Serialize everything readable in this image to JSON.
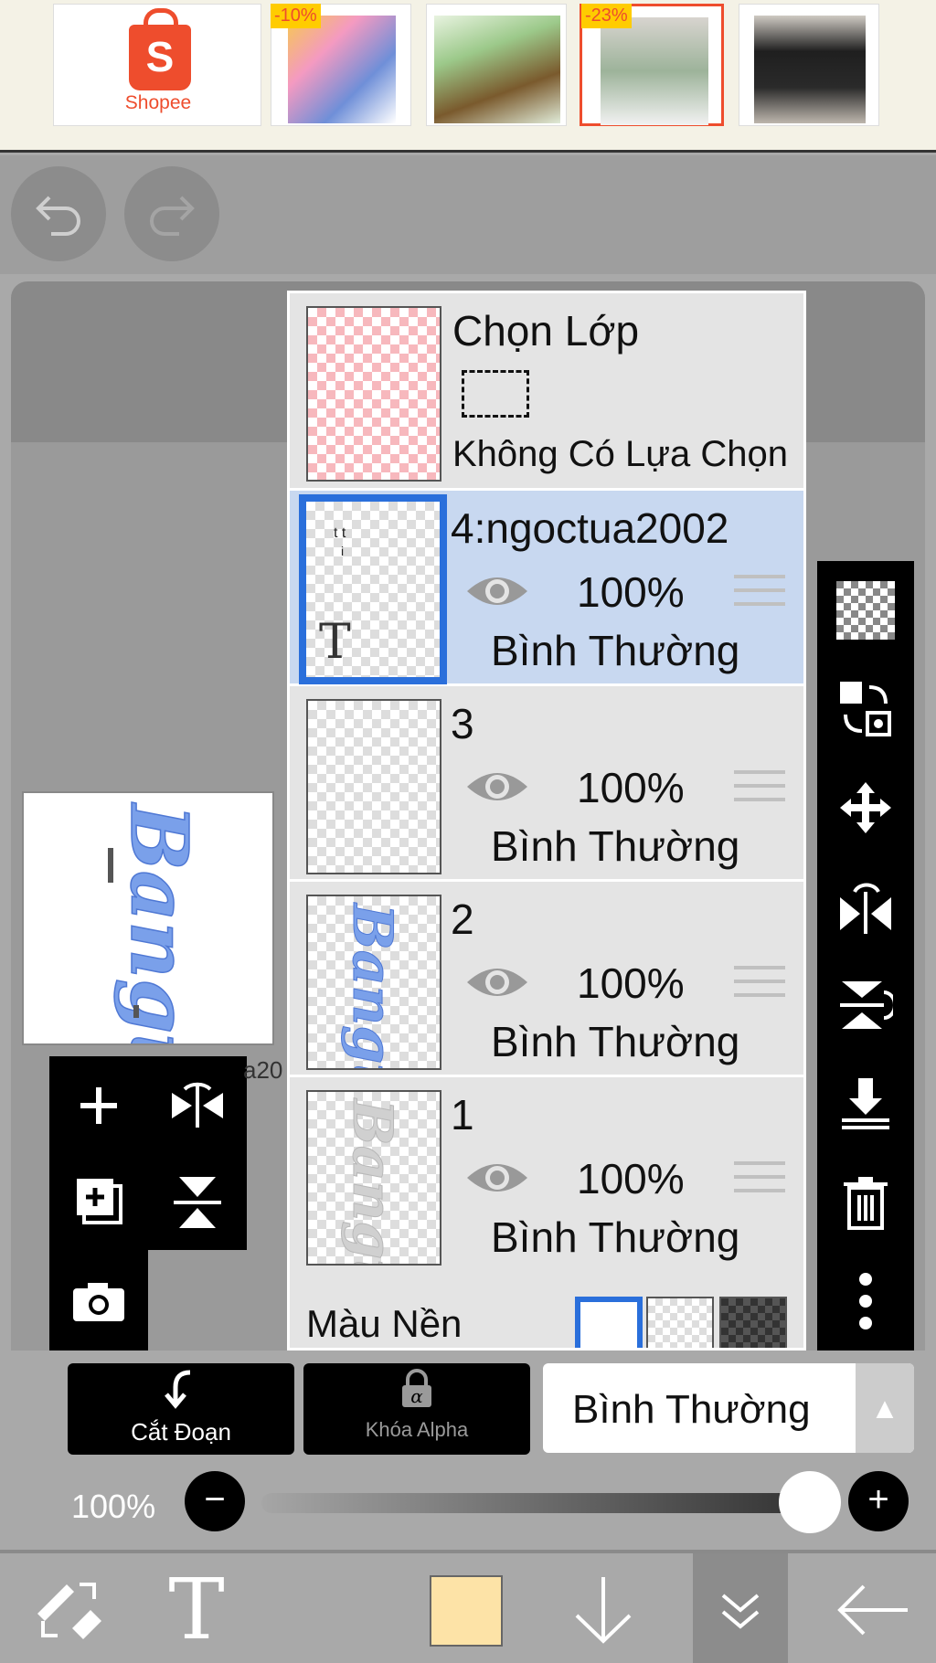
{
  "ad_banner": {
    "brand": "Shopee",
    "badges": [
      "-10%",
      "-23%"
    ]
  },
  "layers_panel": {
    "select_layer": {
      "title": "Chọn Lớp",
      "status": "Không Có Lựa Chọn"
    },
    "layers": [
      {
        "name": "4:ngoctua2002",
        "opacity": "100%",
        "blend": "Bình Thường",
        "selected": true
      },
      {
        "name": "3",
        "opacity": "100%",
        "blend": "Bình Thường",
        "selected": false
      },
      {
        "name": "2",
        "opacity": "100%",
        "blend": "Bình Thường",
        "selected": false
      },
      {
        "name": "1",
        "opacity": "100%",
        "blend": "Bình Thường",
        "selected": false
      }
    ],
    "background_label": "Màu Nền"
  },
  "layer_peek": "a20",
  "controls": {
    "clip_label": "Cắt Đoạn",
    "alpha_lock_label": "Khóa Alpha",
    "blend_mode": "Bình Thường",
    "opacity_text": "100%",
    "opacity_value": 1.0
  },
  "colors": {
    "accent": "#2a6fdb",
    "selected_row": "#c8d8f0",
    "current_color": "#fde3a7",
    "shopee": "#ee4d2d"
  }
}
